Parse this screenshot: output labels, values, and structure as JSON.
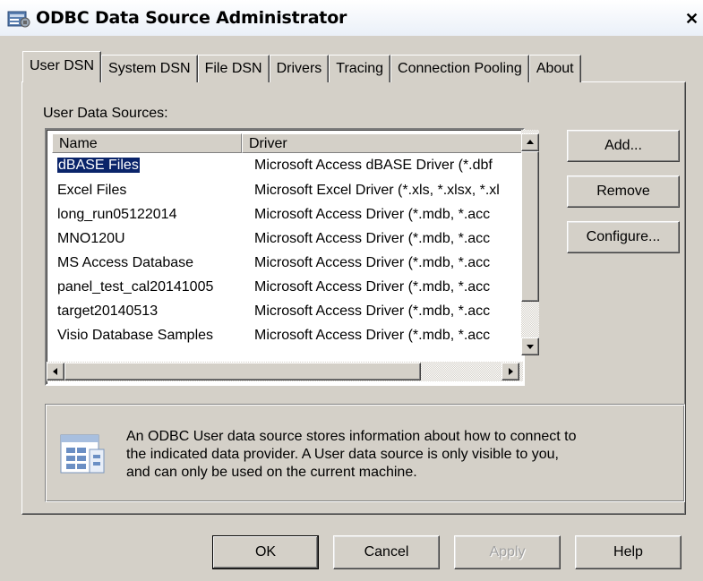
{
  "window": {
    "title": "ODBC Data Source Administrator",
    "close_label": "✕"
  },
  "tabs": [
    {
      "label": "User DSN",
      "active": true
    },
    {
      "label": "System DSN",
      "active": false
    },
    {
      "label": "File DSN",
      "active": false
    },
    {
      "label": "Drivers",
      "active": false
    },
    {
      "label": "Tracing",
      "active": false
    },
    {
      "label": "Connection Pooling",
      "active": false
    },
    {
      "label": "About",
      "active": false
    }
  ],
  "list": {
    "label": "User Data Sources:",
    "columns": [
      "Name",
      "Driver"
    ],
    "rows": [
      {
        "name": "dBASE Files",
        "driver": "Microsoft Access dBASE Driver (*.dbf",
        "selected": true
      },
      {
        "name": "Excel Files",
        "driver": "Microsoft Excel Driver (*.xls, *.xlsx, *.xl"
      },
      {
        "name": "long_run05122014",
        "driver": "Microsoft Access Driver (*.mdb, *.acc"
      },
      {
        "name": "MNO120U",
        "driver": "Microsoft Access Driver (*.mdb, *.acc"
      },
      {
        "name": "MS Access Database",
        "driver": "Microsoft Access Driver (*.mdb, *.acc"
      },
      {
        "name": "panel_test_cal20141005",
        "driver": "Microsoft Access Driver (*.mdb, *.acc"
      },
      {
        "name": "target20140513",
        "driver": "Microsoft Access Driver (*.mdb, *.acc"
      },
      {
        "name": "Visio Database Samples",
        "driver": "Microsoft Access Driver (*.mdb, *.acc"
      }
    ]
  },
  "side_buttons": {
    "add": "Add...",
    "remove": "Remove",
    "configure": "Configure..."
  },
  "info": {
    "line1": "An ODBC User data source stores information about how to connect to",
    "line2": "the indicated data provider.   A User data source is only visible to you,",
    "line3": "and can only be used on the current machine."
  },
  "footer": {
    "ok": "OK",
    "cancel": "Cancel",
    "apply": "Apply",
    "help": "Help"
  },
  "colors": {
    "face": "#d4d0c8",
    "selection": "#0a246a"
  }
}
